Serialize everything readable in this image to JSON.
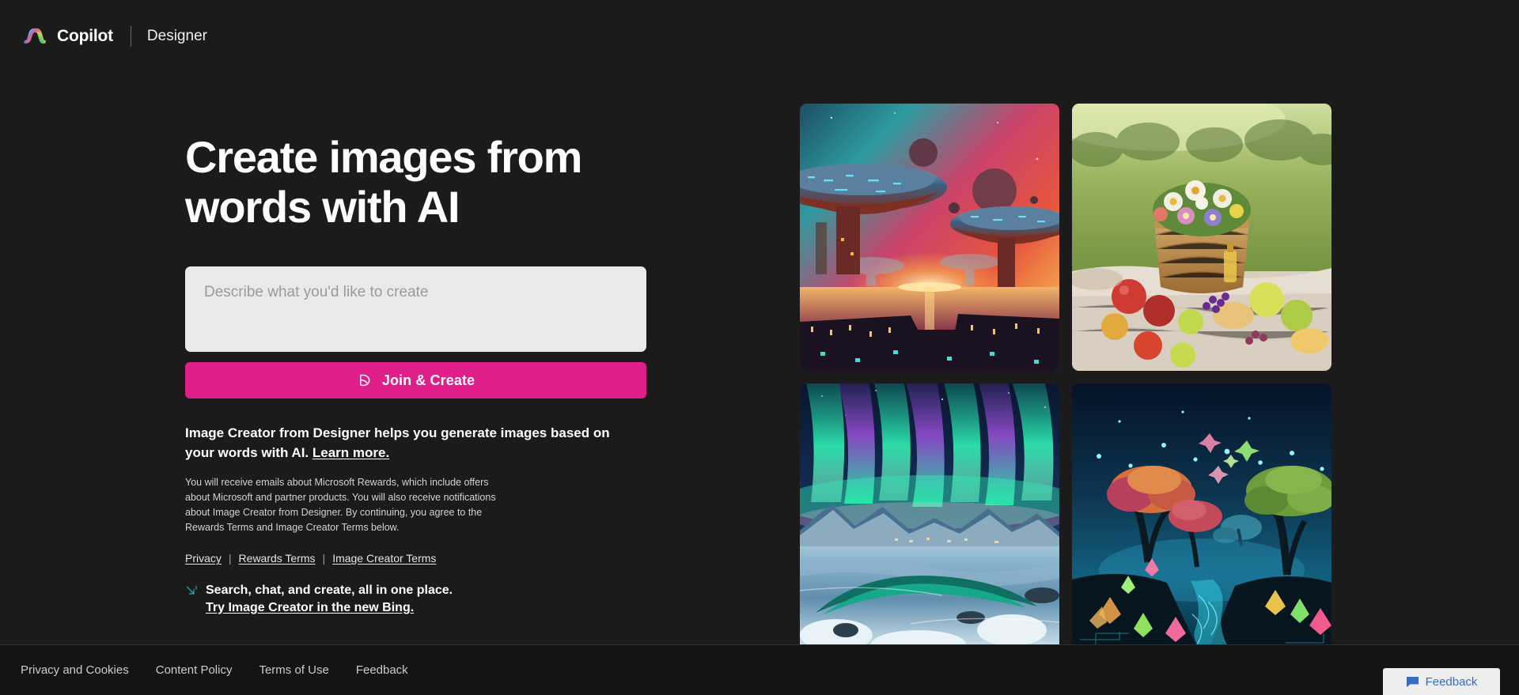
{
  "header": {
    "logo_icon": "copilot-logo-icon",
    "brand_name": "Copilot",
    "app_name": "Designer"
  },
  "hero": {
    "title": "Create images from words with AI",
    "prompt_placeholder": "Describe what you'd like to create",
    "prompt_value": "",
    "cta_label": "Join & Create",
    "cta_icon": "designer-icon",
    "cta_color": "#e01e8a"
  },
  "blurb": {
    "text": "Image Creator from Designer helps you generate images based on your words with AI.",
    "learn_more": "Learn more."
  },
  "fineprint": {
    "text": "You will receive emails about Microsoft Rewards, which include offers about Microsoft and partner products. You will also receive notifications about Image Creator from Designer. By continuing, you agree to the Rewards Terms and Image Creator Terms below."
  },
  "legal_links": {
    "separator": "|",
    "items": [
      {
        "label": "Privacy"
      },
      {
        "label": "Rewards Terms"
      },
      {
        "label": "Image Creator Terms"
      }
    ]
  },
  "bing_promo": {
    "icon": "bing-sparkle-icon",
    "line1": "Search, chat, and create, all in one place.",
    "line2": "Try Image Creator in the new Bing."
  },
  "gallery": {
    "tiles": [
      {
        "name": "sci-fi-city-sunset-image",
        "alt": "Futuristic floating disc city over a glowing river at sunset under a red and teal nebula"
      },
      {
        "name": "picnic-basket-flowers-image",
        "alt": "Picnic basket of wildflowers with fruit on a blanket in a sunlit meadow"
      },
      {
        "name": "aurora-snow-landscape-image",
        "alt": "Green and purple aurora over a snowy mountain valley with a winding river"
      },
      {
        "name": "neon-cyber-forest-image",
        "alt": "Glowing digital forest with neon trees, lotus flowers and a luminous stream"
      }
    ],
    "partial_row_visible": true
  },
  "footer": {
    "links": [
      {
        "label": "Privacy and Cookies"
      },
      {
        "label": "Content Policy"
      },
      {
        "label": "Terms of Use"
      },
      {
        "label": "Feedback"
      }
    ]
  },
  "feedback_button": {
    "label": "Feedback",
    "icon": "speech-bubble-icon",
    "color": "#3a6bc4"
  }
}
